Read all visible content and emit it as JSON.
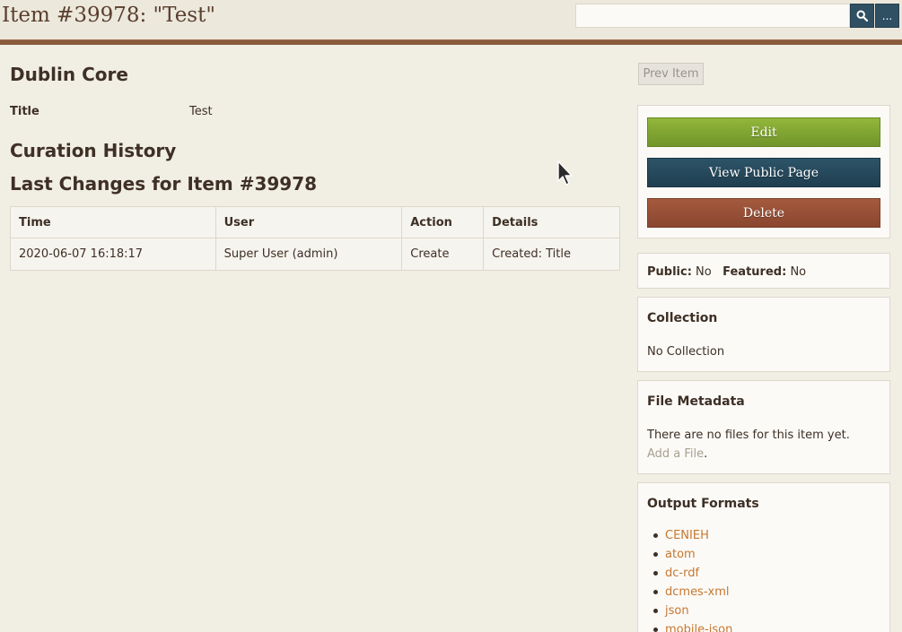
{
  "header": {
    "title": "Item #39978: \"Test\"",
    "search": {
      "value": "",
      "placeholder": ""
    },
    "more_label": "..."
  },
  "main": {
    "element_set": "Dublin Core",
    "fields": [
      {
        "label": "Title",
        "value": "Test"
      }
    ],
    "curation_heading": "Curation History",
    "last_changes_heading": "Last Changes for Item #39978",
    "history": {
      "columns": [
        "Time",
        "User",
        "Action",
        "Details"
      ],
      "rows": [
        [
          "2020-06-07 16:18:17",
          "Super User (admin)",
          "Create",
          "Created: Title"
        ]
      ]
    }
  },
  "sidebar": {
    "prev_label": "Prev Item",
    "edit_label": "Edit",
    "view_label": "View Public Page",
    "delete_label": "Delete",
    "public_label": "Public:",
    "public_value": "No",
    "featured_label": "Featured:",
    "featured_value": "No",
    "collection_title": "Collection",
    "collection_value": "No Collection",
    "file_title": "File Metadata",
    "file_text": "There are no files for this item yet.",
    "file_link": "Add a File",
    "file_text_end": ".",
    "output_title": "Output Formats",
    "formats": [
      "CENIEH",
      "atom",
      "dc-rdf",
      "dcmes-xml",
      "json",
      "mobile-json"
    ]
  },
  "colors": {
    "edit": "#7fa232",
    "view": "#264a5c",
    "delete": "#985036",
    "link": "#c7772f",
    "header_bar": "#8a5a3c"
  }
}
